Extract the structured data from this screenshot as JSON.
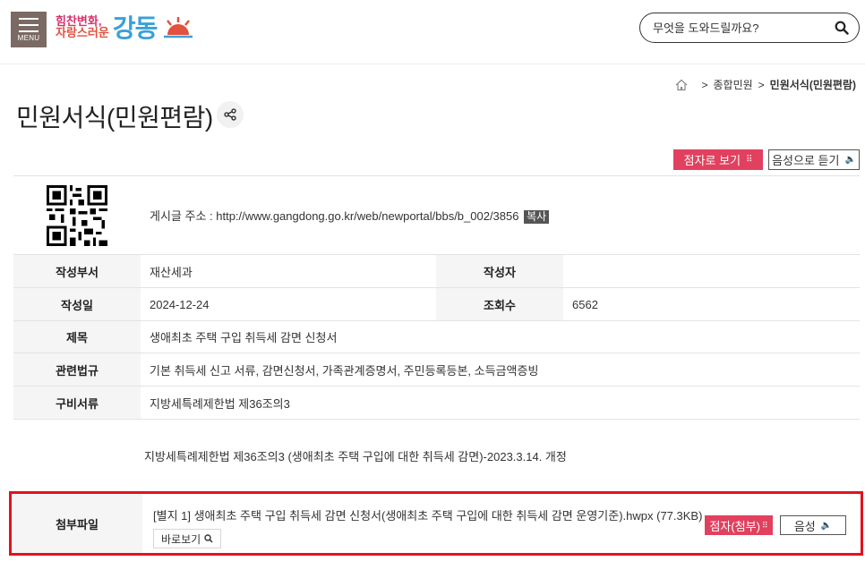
{
  "header": {
    "menu_label": "MENU",
    "logo_line1": "힘찬변화,",
    "logo_line2": "자랑스러운",
    "logo_main": "강동",
    "search_placeholder": "무엇을 도와드릴까요?"
  },
  "breadcrumb": {
    "items": [
      "종합민원",
      "민원서식(민원편람)"
    ]
  },
  "page_title": "민원서식(민원편람)",
  "actions": {
    "braille_label": "점자로 보기",
    "voice_label": "음성으로 듣기"
  },
  "post": {
    "address_label": "게시글 주소 : http://www.gangdong.go.kr/web/newportal/bbs/b_002/3856",
    "copy_label": "복사",
    "department_label": "작성부서",
    "department_value": "재산세과",
    "author_label": "작성자",
    "author_value": "",
    "date_label": "작성일",
    "date_value": "2024-12-24",
    "views_label": "조회수",
    "views_value": "6562",
    "subject_label": "제목",
    "subject_value": "생애최초 주택 구입 취득세 감면 신청서",
    "law_label": "관련법규",
    "law_value": "기본 취득세 신고 서류, 감면신청서, 가족관계증명서, 주민등록등본, 소득금액증빙",
    "docs_label": "구비서류",
    "docs_value": "지방세특례제한법 제36조의3",
    "description": "지방세특례제한법 제36조의3 (생애최초 주택 구입에 대한 취득세 감면)-2023.3.14. 개정"
  },
  "attachment": {
    "label": "첨부파일",
    "file_name": "[별지 1] 생애최초 주택 구입 취득세 감면 신청서(생애최초 주택 구입에 대한 취득세 감면 운영기준).hwpx (77.3KB)",
    "preview_label": "바로보기",
    "braille_label": "점자(첨부)",
    "voice_label": "음성"
  },
  "colors": {
    "accent": "#e2405f",
    "highlight_border": "#e0131e",
    "menu_bg": "#7a6a63",
    "logo_blue": "#3aa0d8"
  },
  "icons": [
    "menu-icon",
    "search-icon",
    "home-icon",
    "share-icon",
    "braille-icon",
    "speaker-icon",
    "magnifier-icon",
    "qr-code-icon"
  ]
}
